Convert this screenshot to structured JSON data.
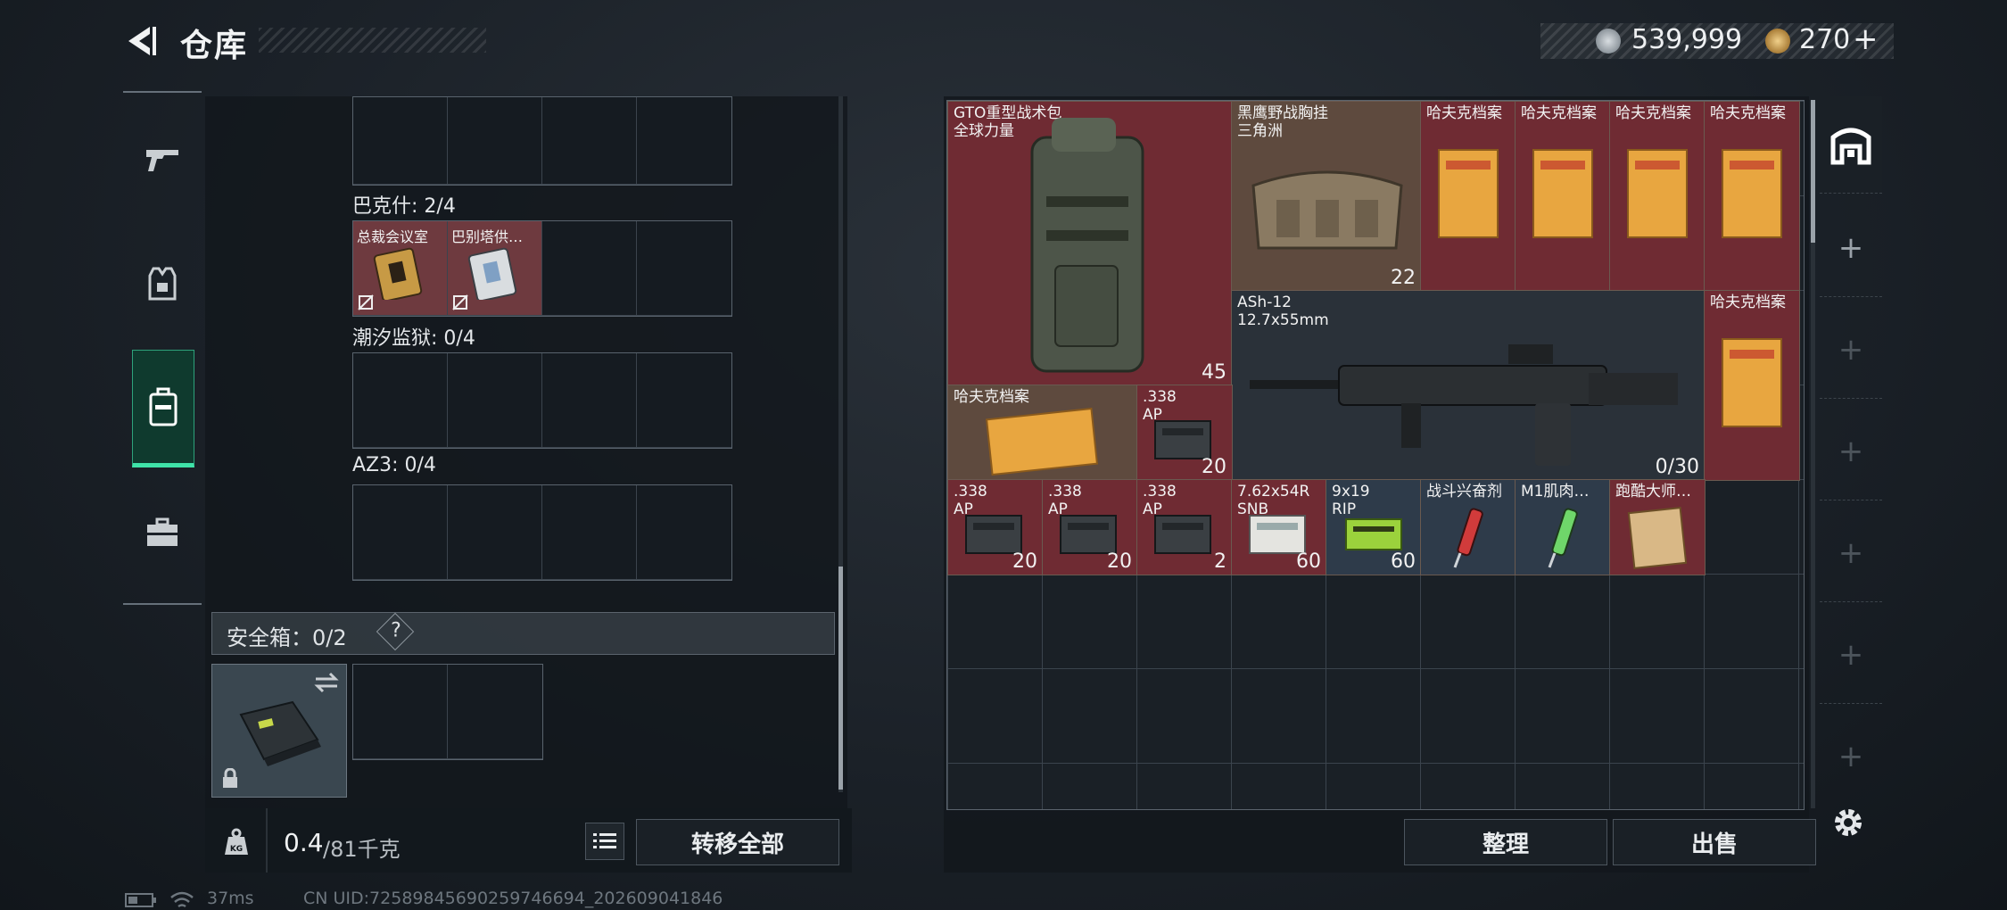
{
  "header": {
    "title": "仓库",
    "currency_silver": "539,999",
    "currency_gold": "270",
    "plus": "+"
  },
  "tabs": [
    {
      "name": "tab-weapons",
      "icon": "gun-icon"
    },
    {
      "name": "tab-gear",
      "icon": "armor-icon"
    },
    {
      "name": "tab-container",
      "icon": "case-icon",
      "active": true
    },
    {
      "name": "tab-briefcase",
      "icon": "briefcase-icon"
    }
  ],
  "left": {
    "sections": [
      {
        "label": "巴克什: 2/4",
        "items": [
          "总裁会议室",
          "巴别塔供…"
        ]
      },
      {
        "label": "潮汐监狱: 0/4",
        "items": []
      },
      {
        "label": "AZ3: 0/4",
        "items": []
      }
    ],
    "safe_box": {
      "label": "安全箱：0/2",
      "help": "?"
    },
    "weight": {
      "current": "0.4",
      "max": "/81千克",
      "kg_icon": "KG"
    },
    "transfer_all": "转移全部"
  },
  "inventory": {
    "items": [
      {
        "name": "GTO重型战术包\n全球力量",
        "count": "45"
      },
      {
        "name": "黑鹰野战胸挂\n三角洲",
        "count": "22"
      },
      {
        "name": "哈夫克档案",
        "count": ""
      },
      {
        "name": "哈夫克档案",
        "count": ""
      },
      {
        "name": "哈夫克档案",
        "count": ""
      },
      {
        "name": "哈夫克档案",
        "count": ""
      },
      {
        "name": "ASh-12\n12.7x55mm",
        "count": "0/30"
      },
      {
        "name": "哈夫克档案",
        "count": ""
      },
      {
        "name": "哈夫克档案",
        "count": ""
      },
      {
        "name": ".338\nAP",
        "count": "20"
      },
      {
        "name": ".338\nAP",
        "count": "20"
      },
      {
        "name": ".338\nAP",
        "count": "20"
      },
      {
        "name": ".338\nAP",
        "count": "2"
      },
      {
        "name": "7.62x54R\nSNB",
        "count": "60"
      },
      {
        "name": "9x19\nRIP",
        "count": "60"
      },
      {
        "name": "战斗兴奋剂",
        "count": ""
      },
      {
        "name": "M1肌肉…",
        "count": ""
      },
      {
        "name": "跑酷大师…",
        "count": ""
      }
    ],
    "tidy": "整理",
    "sell": "出售"
  },
  "status_bar": {
    "ping": "37ms",
    "uid": "CN UID:7258984569025974669‌4_202609041846"
  },
  "colors": {
    "accent": "#3fe3a8",
    "rare_red": "#6f2b33",
    "epic_brown": "#5e4a3e",
    "blue": "#2e3b4a"
  }
}
